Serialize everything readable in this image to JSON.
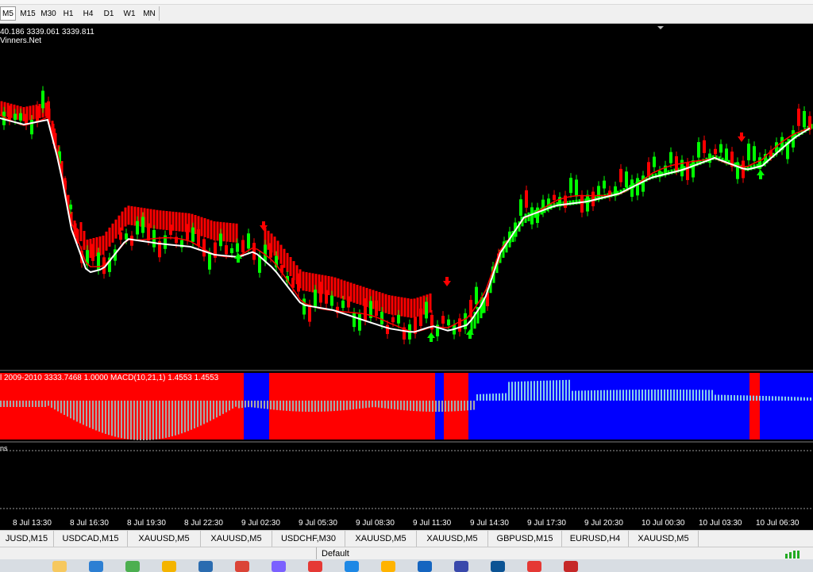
{
  "toolbar": {
    "timeframes": [
      "M5",
      "M15",
      "M30",
      "H1",
      "H4",
      "D1",
      "W1",
      "MN"
    ],
    "selected": "M5"
  },
  "chart": {
    "info_line": "40.186 3339.061 3339.811",
    "info_line2": "Vinners.Net",
    "colors": {
      "background": "#000000",
      "bull_candle": "#00ff00",
      "bear_candle": "#ff0000",
      "fast_ma": "#ff0000",
      "slow_ma": "#ffffff",
      "band_fill": "#00ff00",
      "buy_arrow": "#00ff00",
      "sell_arrow": "#ff0000"
    }
  },
  "indicator": {
    "label": "l 2009-2010  3333.7468 1.0000  MACD(10,21,1) 1.4553 1.4553",
    "colors": {
      "bear_zone": "#ff0000",
      "bull_zone": "#0000ff",
      "histogram": "#87ceeb"
    }
  },
  "indicator3": {
    "label": "ns"
  },
  "x_axis": [
    "8 Jul 13:30",
    "8 Jul 16:30",
    "8 Jul 19:30",
    "8 Jul 22:30",
    "9 Jul 02:30",
    "9 Jul 05:30",
    "9 Jul 08:30",
    "9 Jul 11:30",
    "9 Jul 14:30",
    "9 Jul 17:30",
    "9 Jul 20:30",
    "10 Jul 00:30",
    "10 Jul 03:30",
    "10 Jul 06:30"
  ],
  "tabs": [
    "JUSD,M15",
    "USDCAD,M15",
    "XAUUSD,M5",
    "XAUUSD,M5",
    "USDCHF,M30",
    "XAUUSD,M5",
    "XAUUSD,M5",
    "GBPUSD,M15",
    "EURUSD,H4",
    "XAUUSD,M5"
  ],
  "status": {
    "profile": "Default"
  },
  "taskbar": {
    "icons": [
      "user-icon",
      "edge-icon",
      "chrome-icon",
      "photos-icon",
      "browser-icon",
      "chrome-icon",
      "store-icon",
      "anydesk-icon",
      "mail-icon",
      "folder-icon",
      "docs-icon",
      "grid-icon",
      "globe-icon",
      "opera-icon",
      "metatrader-icon"
    ],
    "icon_colors": [
      "#f6c85f",
      "#2d7fd3",
      "#4caf50",
      "#f4b400",
      "#2b6cb0",
      "#db4437",
      "#7b61ff",
      "#e53935",
      "#1e88e5",
      "#ffb300",
      "#1565c0",
      "#3949ab",
      "#0b5394",
      "#e53935",
      "#c62828"
    ]
  }
}
